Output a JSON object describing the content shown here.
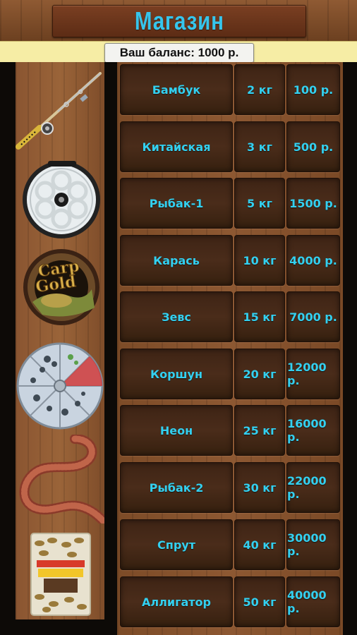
{
  "header": {
    "title": "Магазин"
  },
  "balance": {
    "text": "Ваш баланс: 1000 р."
  },
  "icons": [
    "fishing-rod-icon",
    "reel-icon",
    "fishing-line-icon",
    "sinkers-box-icon",
    "worm-bait-icon",
    "groundbait-icon"
  ],
  "shop": {
    "items": [
      {
        "name": "Бамбук",
        "weight": "2 кг",
        "price": "100 р."
      },
      {
        "name": "Китайская",
        "weight": "3 кг",
        "price": "500 р."
      },
      {
        "name": "Рыбак-1",
        "weight": "5 кг",
        "price": "1500 р."
      },
      {
        "name": "Карась",
        "weight": "10 кг",
        "price": "4000 р."
      },
      {
        "name": "Зевс",
        "weight": "15 кг",
        "price": "7000 р."
      },
      {
        "name": "Коршун",
        "weight": "20 кг",
        "price": "12000 р."
      },
      {
        "name": "Неон",
        "weight": "25 кг",
        "price": "16000 р."
      },
      {
        "name": "Рыбак-2",
        "weight": "30 кг",
        "price": "22000 р."
      },
      {
        "name": "Спрут",
        "weight": "40 кг",
        "price": "30000 р."
      },
      {
        "name": "Аллигатор",
        "weight": "50 кг",
        "price": "40000 р."
      }
    ]
  },
  "colors": {
    "accent": "#33d0f0",
    "balance_strip": "#f6eda5"
  }
}
